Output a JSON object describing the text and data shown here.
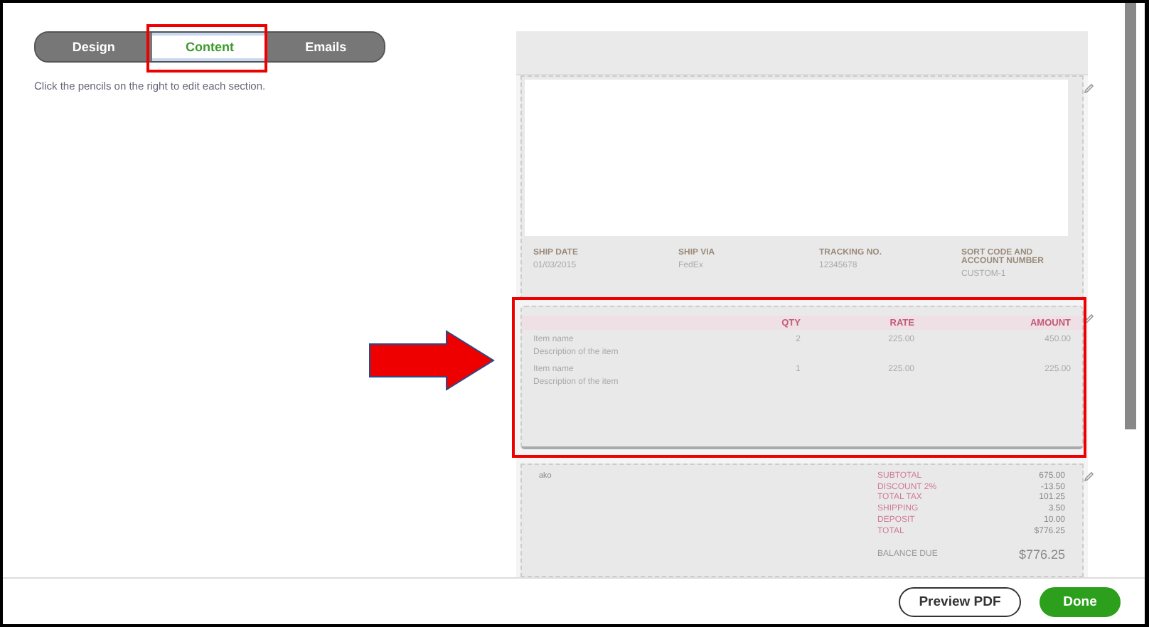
{
  "tabs": [
    {
      "label": "Design",
      "selected": false
    },
    {
      "label": "Content",
      "selected": true
    },
    {
      "label": "Emails",
      "selected": false
    }
  ],
  "hint": "Click the pencils on the right to edit each section.",
  "preview": {
    "shipping": [
      {
        "label": "SHIP DATE",
        "value": "01/03/2015"
      },
      {
        "label": "SHIP VIA",
        "value": "FedEx"
      },
      {
        "label": "TRACKING NO.",
        "value": "12345678"
      },
      {
        "label": "SORT CODE AND ACCOUNT NUMBER",
        "value": "CUSTOM-1"
      }
    ],
    "columns": [
      "QTY",
      "RATE",
      "AMOUNT"
    ],
    "items": [
      {
        "name": "Item name",
        "description": "Description of the item",
        "qty": "2",
        "rate": "225.00",
        "amount": "450.00"
      },
      {
        "name": "Item name",
        "description": "Description of the item",
        "qty": "1",
        "rate": "225.00",
        "amount": "225.00"
      }
    ],
    "note": "ako",
    "totals": [
      {
        "label": "SUBTOTAL",
        "value": "675.00"
      },
      {
        "label": "DISCOUNT 2%",
        "value": "-13.50"
      },
      {
        "label": "TOTAL TAX",
        "value": "101.25"
      },
      {
        "label": "SHIPPING",
        "value": "3.50"
      },
      {
        "label": "DEPOSIT",
        "value": "10.00"
      },
      {
        "label": "TOTAL",
        "value": "$776.25"
      }
    ],
    "balance_due": {
      "label": "BALANCE DUE",
      "value": "$776.25"
    }
  },
  "buttons": [
    {
      "label": "Preview PDF",
      "kind": "secondary"
    },
    {
      "label": "Done",
      "kind": "primary"
    }
  ]
}
